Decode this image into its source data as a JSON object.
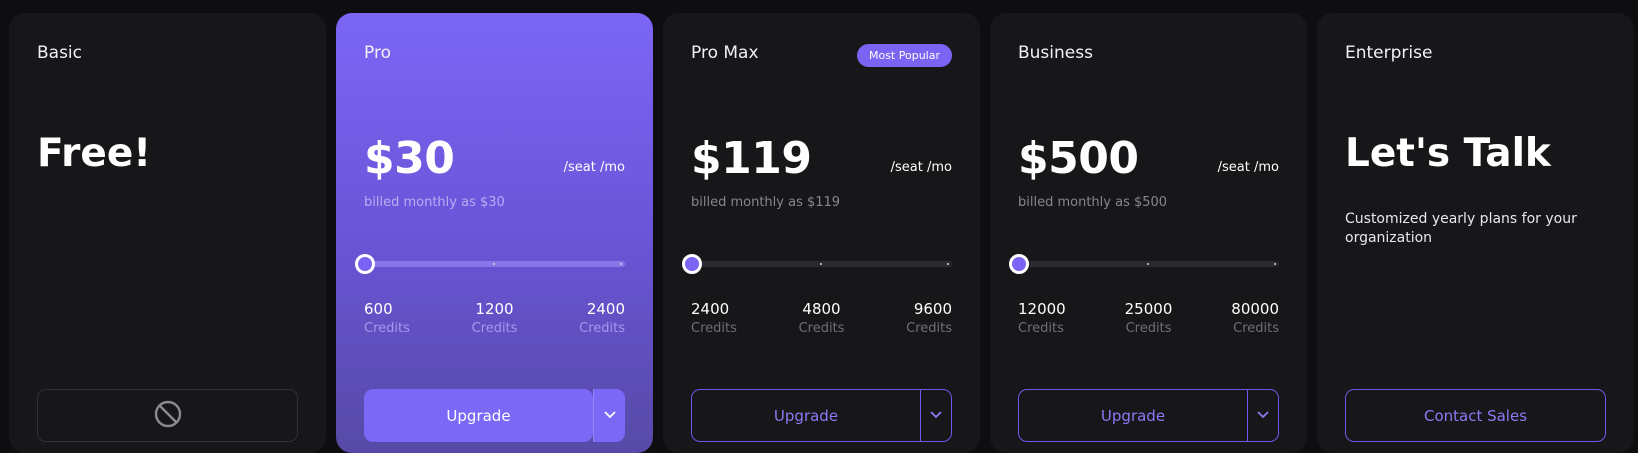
{
  "plans": [
    {
      "name": "Basic",
      "headline": "Free!",
      "button": {
        "icon": "prohibited-icon",
        "disabled": true
      }
    },
    {
      "name": "Pro",
      "price": "$30",
      "per": "/seat /mo",
      "billed": "billed monthly as $30",
      "slider_value": 0,
      "credits": [
        {
          "amount": "600",
          "unit": "Credits"
        },
        {
          "amount": "1200",
          "unit": "Credits"
        },
        {
          "amount": "2400",
          "unit": "Credits"
        }
      ],
      "button": {
        "label": "Upgrade",
        "style": "solid",
        "dropdown_icon": "chevron-down-icon"
      }
    },
    {
      "name": "Pro Max",
      "badge": "Most Popular",
      "price": "$119",
      "per": "/seat /mo",
      "billed": "billed monthly as $119",
      "slider_value": 0,
      "credits": [
        {
          "amount": "2400",
          "unit": "Credits"
        },
        {
          "amount": "4800",
          "unit": "Credits"
        },
        {
          "amount": "9600",
          "unit": "Credits"
        }
      ],
      "button": {
        "label": "Upgrade",
        "style": "outline",
        "dropdown_icon": "chevron-down-icon"
      }
    },
    {
      "name": "Business",
      "price": "$500",
      "per": "/seat /mo",
      "billed": "billed monthly as $500",
      "slider_value": 0,
      "credits": [
        {
          "amount": "12000",
          "unit": "Credits"
        },
        {
          "amount": "25000",
          "unit": "Credits"
        },
        {
          "amount": "80000",
          "unit": "Credits"
        }
      ],
      "button": {
        "label": "Upgrade",
        "style": "outline",
        "dropdown_icon": "chevron-down-icon"
      }
    },
    {
      "name": "Enterprise",
      "headline": "Let's Talk",
      "description": "Customized yearly plans for your organization",
      "button": {
        "label": "Contact Sales",
        "style": "outline"
      }
    }
  ],
  "colors": {
    "accent": "#7c68f7",
    "card_bg": "#17171a",
    "page_bg": "#0e0e10"
  }
}
